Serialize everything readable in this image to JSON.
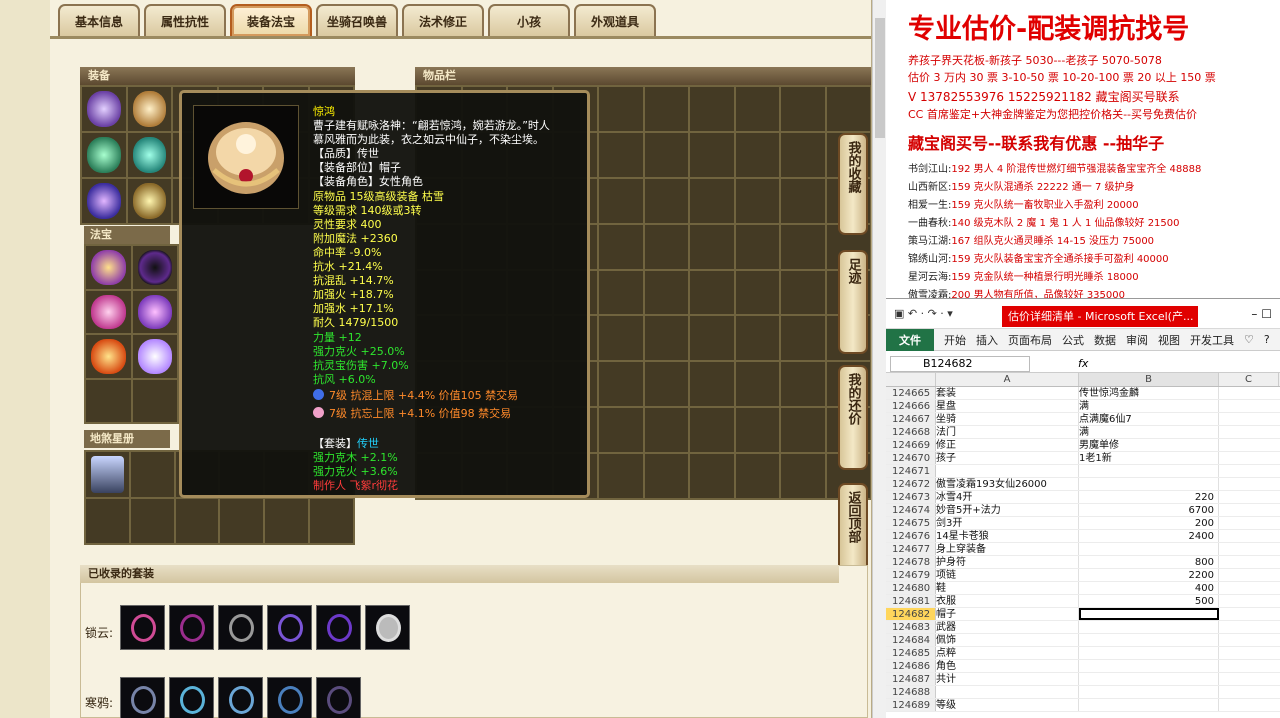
{
  "tabs": [
    "基本信息",
    "属性抗性",
    "装备法宝",
    "坐骑召唤兽",
    "法术修正",
    "小孩",
    "外观道具"
  ],
  "panels": {
    "equip": "装备",
    "inventory": "物品栏",
    "fabao": "法宝",
    "star": "地煞星册",
    "suit": "已收录的套装"
  },
  "suits": [
    {
      "label": "锁云:"
    },
    {
      "label": "寒鸦:"
    }
  ],
  "side_buttons": [
    {
      "label": "我的收藏"
    },
    {
      "label": "足迹"
    },
    {
      "label": "我的还价"
    },
    {
      "label": "返回顶部"
    }
  ],
  "tooltip": {
    "name": "惊鸿",
    "desc1": "曹子建有赋咏洛神：“翩若惊鸿，婉若游龙。”时人",
    "desc2": "慕风雅而为此装，衣之如云中仙子，不染尘埃。",
    "lines_white": [
      "【品质】传世",
      "【装备部位】帽子",
      "【装备角色】女性角色"
    ],
    "lines_yellow": [
      "原物品 15级高级装备 枯雪",
      "等级需求 140级或3转",
      "灵性要求 400",
      "附加魔法 +2360",
      "命中率 -9.0%",
      "抗水 +21.4%",
      "抗混乱 +14.7%",
      "加强火 +18.7%",
      "加强水 +17.1%",
      "耐久 1479/1500"
    ],
    "lines_green": [
      "力量 +12",
      "强力克火 +25.0%",
      "抗灵宝伤害 +7.0%",
      "抗风 +6.0%"
    ],
    "gems": [
      "7级 抗混上限 +4.4% 价值105 禁交易",
      "7级 抗忘上限 +4.1% 价值98 禁交易"
    ],
    "suit_label": "【套装】",
    "suit_name": "传世",
    "suit_bonus": [
      "强力克木 +2.1%",
      "强力克火 +3.6%"
    ],
    "maker": "制作人 飞絮r彻花"
  },
  "ad": {
    "title": "专业估价-配装调抗找号",
    "line1": "养孩子界天花板-新孩子 5030---老孩子 5070-5078",
    "line2": "估价 3 万内 30 票    3-10-50 票    10-20-100 票    20 以上 150 票",
    "contact": "V  13782553976      15225921182    藏宝阁买号联系",
    "cc": "CC 首席鉴定+大神金牌鉴定为您把控价格关--买号免费估价",
    "mid": "藏宝阁买号--联系我有优惠 --抽华子",
    "items": [
      {
        "server": "书剑江山:",
        "desc": "192 男人 4 阶混传世燃灯细节强混装备宝宝齐全 48888"
      },
      {
        "server": "山西新区:",
        "desc": "159 克火队混通杀 22222 通一 7 级护身"
      },
      {
        "server": "相爱一生:",
        "desc": "159 克火队统一畜牧职业入手盈利 20000"
      },
      {
        "server": "一曲春秋:",
        "desc": "140 级克木队 2 魔 1 鬼 1 人 1 仙品像较好 21500"
      },
      {
        "server": "策马江湖:",
        "desc": "167 组队克火通灵睡杀 14-15 没压力 75000"
      },
      {
        "server": "锦绣山河:",
        "desc": "159 克火队装备宝宝齐全通杀接手可盈利 40000"
      },
      {
        "server": "星河云海:",
        "desc": "159 克金队统一种植景行明光睡杀 18000"
      },
      {
        "server": "傲雪凌霜:",
        "desc": "200 男人物有所值，品像较好 335000"
      }
    ]
  },
  "excel": {
    "qat": "▣ ↶ · ↷ · ▾",
    "title": "估价详细清单 - Microsoft Excel(产...",
    "win": "–  ☐",
    "menu": [
      "开始",
      "插入",
      "页面布局",
      "公式",
      "数据",
      "审阅",
      "视图",
      "开发工具",
      "♡",
      "?"
    ],
    "file": "文件",
    "namebox": "B124682",
    "fx": "fx",
    "cols": [
      "A",
      "B",
      "C"
    ],
    "rows": [
      {
        "n": "124665",
        "a": "套装",
        "b": "传世惊鸿金麟",
        "num": false
      },
      {
        "n": "124666",
        "a": "星盘",
        "b": "满",
        "num": false
      },
      {
        "n": "124667",
        "a": "坐骑",
        "b": "点满魔6仙7",
        "num": false
      },
      {
        "n": "124668",
        "a": "法门",
        "b": "满",
        "num": false
      },
      {
        "n": "124669",
        "a": "修正",
        "b": "男魔单修",
        "num": false
      },
      {
        "n": "124670",
        "a": "孩子",
        "b": "1老1新",
        "num": false
      },
      {
        "n": "124671",
        "a": "",
        "b": "",
        "num": false
      },
      {
        "n": "124672",
        "a": "傲雪凌霜193女仙26000",
        "b": "",
        "num": false
      },
      {
        "n": "124673",
        "a": "冰雪4开",
        "b": "220",
        "num": true
      },
      {
        "n": "124674",
        "a": "妙音5开+法力",
        "b": "6700",
        "num": true
      },
      {
        "n": "124675",
        "a": "剑3开",
        "b": "200",
        "num": true
      },
      {
        "n": "124676",
        "a": "14星卡苍狼",
        "b": "2400",
        "num": true
      },
      {
        "n": "124677",
        "a": "身上穿装备",
        "b": "",
        "num": false
      },
      {
        "n": "124678",
        "a": "护身符",
        "b": "800",
        "num": true
      },
      {
        "n": "124679",
        "a": "项链",
        "b": "2200",
        "num": true
      },
      {
        "n": "124680",
        "a": "鞋",
        "b": "400",
        "num": true
      },
      {
        "n": "124681",
        "a": "衣服",
        "b": "500",
        "num": true
      },
      {
        "n": "124682",
        "a": "帽子",
        "b": "",
        "num": false,
        "sel": true
      },
      {
        "n": "124683",
        "a": "武器",
        "b": "",
        "num": false
      },
      {
        "n": "124684",
        "a": "佩饰",
        "b": "",
        "num": false
      },
      {
        "n": "124685",
        "a": "点粹",
        "b": "",
        "num": false
      },
      {
        "n": "124686",
        "a": "角色",
        "b": "",
        "num": false
      },
      {
        "n": "124687",
        "a": "共计",
        "b": "",
        "num": false
      },
      {
        "n": "124688",
        "a": "",
        "b": "",
        "num": false
      },
      {
        "n": "124689",
        "a": "等级",
        "b": "",
        "num": false
      }
    ]
  }
}
